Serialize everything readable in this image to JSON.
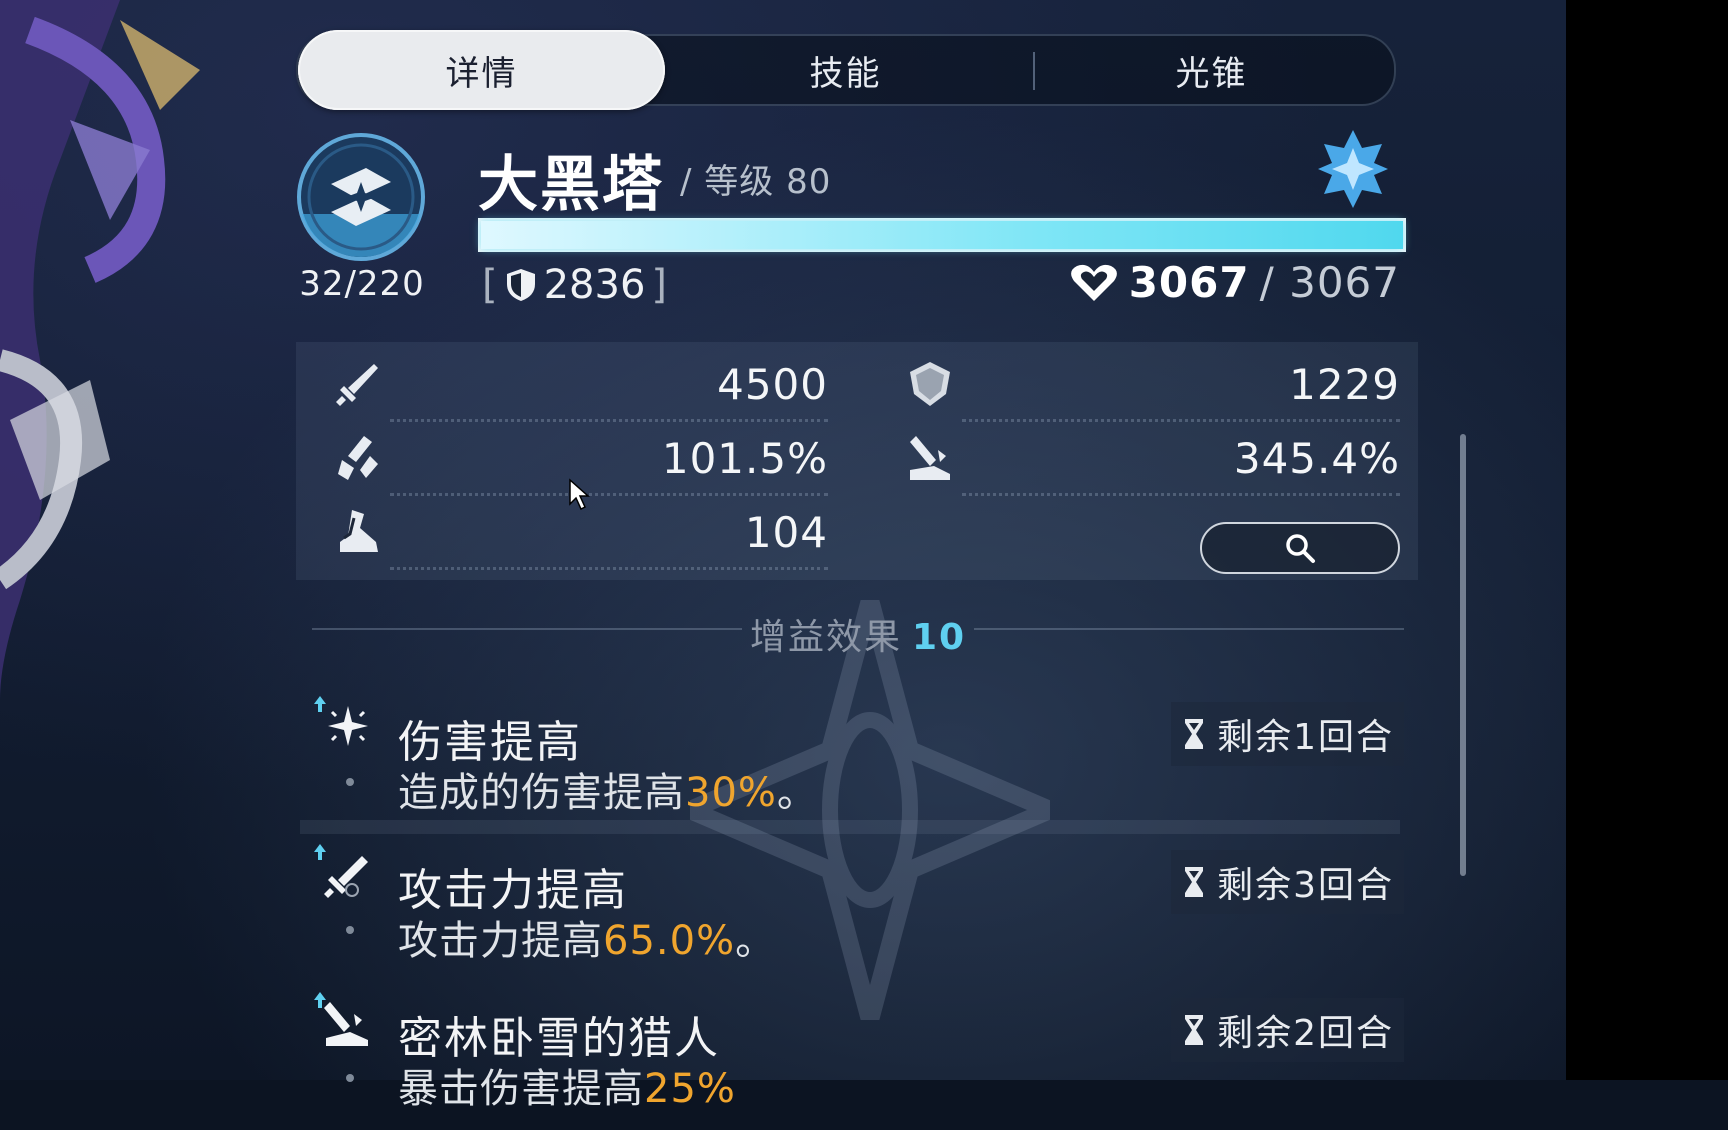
{
  "tabs": [
    {
      "label": "详情",
      "active": true
    },
    {
      "label": "技能",
      "active": false
    },
    {
      "label": "光锥",
      "active": false
    }
  ],
  "character": {
    "name": "大黑塔",
    "level_text": "/ 等级 80",
    "energy": "32/220",
    "hp_fraction": 1.0,
    "shield_value": "2836",
    "hp_current": "3067",
    "hp_max": "/ 3067",
    "element_icon": "ice-element-icon",
    "path_icon": "erudition-path-icon"
  },
  "stats": [
    {
      "icon": "atk-sword-icon",
      "value": "4500"
    },
    {
      "icon": "def-shield-icon",
      "value": "1229"
    },
    {
      "icon": "crit-rate-icon",
      "value": "101.5%"
    },
    {
      "icon": "crit-dmg-icon",
      "value": "345.4%"
    },
    {
      "icon": "speed-boot-icon",
      "value": "104"
    }
  ],
  "buff_section": {
    "title": "增益效果",
    "count": "10"
  },
  "buffs": [
    {
      "title": "伤害提高",
      "desc_prefix": "造成的伤害提高",
      "desc_value": "30%",
      "desc_suffix": "。",
      "turns": "剩余1回合"
    },
    {
      "title": "攻击力提高",
      "desc_prefix": "攻击力提高",
      "desc_value": "65.0%",
      "desc_suffix": "。",
      "turns": "剩余3回合"
    },
    {
      "title": "密林卧雪的猎人",
      "desc_prefix": "暴击伤害提高",
      "desc_value": "25%",
      "desc_suffix": "",
      "turns": "剩余2回合"
    }
  ],
  "colors": {
    "accent_cyan": "#5fd0f0",
    "highlight_orange": "#f0a52e",
    "ice_blue": "#4aa8e8"
  }
}
